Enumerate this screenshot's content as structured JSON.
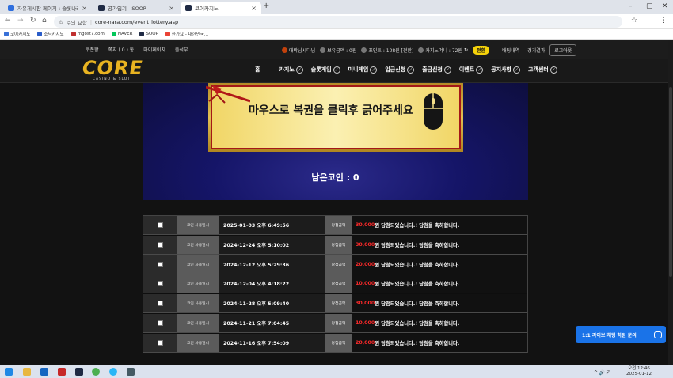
{
  "browser": {
    "tabs": [
      {
        "label": "자유게시판 페이지 : 슬롯나라",
        "color": "#2f6fde",
        "active": false
      },
      {
        "label": "공가입기 - SOOP",
        "color": "#1f2a44",
        "active": false
      },
      {
        "label": "코어카지노",
        "color": "#1f2a44",
        "active": true
      }
    ],
    "new_tab": "+",
    "url_warning": "주의 요함",
    "url": "core-nara.com/event_lottery.asp",
    "bookmarks": [
      {
        "label": "코어카지노",
        "color": "#3870d8"
      },
      {
        "label": "소닉카지노",
        "color": "#2a5cc9"
      },
      {
        "label": "mgost7.com",
        "color": "#c03030"
      },
      {
        "label": "NAVER",
        "color": "#03c75a"
      },
      {
        "label": "SOOP",
        "color": "#1f2a44"
      },
      {
        "label": "한가요 - 대한민국...",
        "color": "#ea4335"
      }
    ]
  },
  "site_top": {
    "links": [
      "쿠폰함",
      "쪽지 ( 0 ) 통",
      "마이페이지",
      "출석부"
    ],
    "user": "대박님시다님",
    "balance": "보유금액 : 0원",
    "points": "포인트 : 108원 [전환]",
    "casino_money": "카지노머니 : 72원",
    "charge": "전환",
    "history": "배팅내역",
    "results": "경기결과",
    "logout": "로그아웃"
  },
  "logo": {
    "main": "CORE",
    "sub": "CASINO & SLOT"
  },
  "menu": [
    {
      "label": "홈",
      "check": false
    },
    {
      "label": "카지노",
      "check": true
    },
    {
      "label": "슬롯게임",
      "check": true
    },
    {
      "label": "미니게임",
      "check": true
    },
    {
      "label": "입금신청",
      "check": true
    },
    {
      "label": "출금신청",
      "check": true
    },
    {
      "label": "이벤트",
      "check": true
    },
    {
      "label": "공지사항",
      "check": true
    },
    {
      "label": "고객센터",
      "check": true
    }
  ],
  "banner": {
    "instruction": "마우스로 복권을 클릭후 긁어주세요",
    "coins_left": "남은코인 : 0"
  },
  "table": {
    "coin_label": "코인 사용일시",
    "win_label": "당첨금액",
    "rows": [
      {
        "date": "2025-01-03 오후 6:49:56",
        "amount": "30,000",
        "suffix": "원 당첨되었습니다.! 당첨을 축하합니다."
      },
      {
        "date": "2024-12-24 오후 5:10:02",
        "amount": "30,000",
        "suffix": "원 당첨되었습니다.! 당첨을 축하합니다."
      },
      {
        "date": "2024-12-12 오후 5:29:36",
        "amount": "20,000",
        "suffix": "원 당첨되었습니다.! 당첨을 축하합니다."
      },
      {
        "date": "2024-12-04 오후 4:18:22",
        "amount": "10,000",
        "suffix": "원 당첨되었습니다.! 당첨을 축하합니다."
      },
      {
        "date": "2024-11-28 오후 5:09:40",
        "amount": "30,000",
        "suffix": "원 당첨되었습니다.! 당첨을 축하합니다."
      },
      {
        "date": "2024-11-21 오후 7:04:45",
        "amount": "10,000",
        "suffix": "원 당첨되었습니다.! 당첨을 축하합니다."
      },
      {
        "date": "2024-11-16 오후 7:54:09",
        "amount": "20,000",
        "suffix": "원 당첨되었습니다.! 당첨을 축하합니다."
      }
    ]
  },
  "chat": {
    "label": "1:1 라이브 채팅 하원 문의"
  },
  "taskbar": {
    "time": "오전 12:46",
    "date": "2025-01-12",
    "tray": "^ 🔊 가"
  }
}
